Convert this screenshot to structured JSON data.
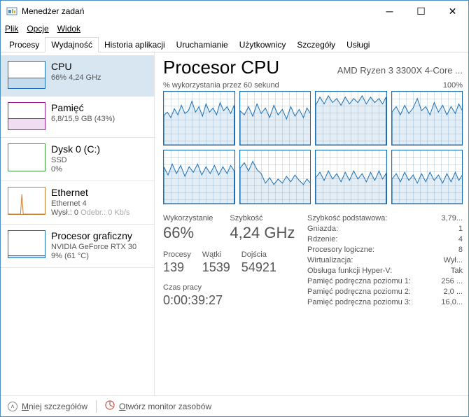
{
  "window": {
    "title": "Menedżer zadań"
  },
  "menu": {
    "file": "Plik",
    "options": "Opcje",
    "view": "Widok"
  },
  "tabs": {
    "t0": "Procesy",
    "t1": "Wydajność",
    "t2": "Historia aplikacji",
    "t3": "Uruchamianie",
    "t4": "Użytkownicy",
    "t5": "Szczegóły",
    "t6": "Usługi"
  },
  "sidebar": {
    "cpu": {
      "title": "CPU",
      "sub": "66%  4,24 GHz"
    },
    "mem": {
      "title": "Pamięć",
      "sub": "6,8/15,9 GB (43%)"
    },
    "disk": {
      "title": "Dysk 0 (C:)",
      "sub": "SSD",
      "sub2": "0%"
    },
    "net": {
      "title": "Ethernet",
      "sub": "Ethernet 4",
      "sent_lbl": "Wysł.: ",
      "sent_val": "0",
      "recv_lbl": " Odebr.: ",
      "recv_val": "0 Kb/s"
    },
    "gpu": {
      "title": "Procesor graficzny",
      "sub": "NVIDIA GeForce RTX 30",
      "sub2": "9%  (61 °C)"
    }
  },
  "main": {
    "heading": "Procesor CPU",
    "model": "AMD Ryzen 3 3300X 4-Core ...",
    "axis_left": "% wykorzystania przez 60 sekund",
    "axis_right": "100%"
  },
  "stats_left": {
    "util_lbl": "Wykorzystanie",
    "util_val": "66%",
    "speed_lbl": "Szybkość",
    "speed_val": "4,24 GHz",
    "proc_lbl": "Procesy",
    "proc_val": "139",
    "thr_lbl": "Wątki",
    "thr_val": "1539",
    "hnd_lbl": "Dojścia",
    "hnd_val": "54921",
    "up_lbl": "Czas pracy",
    "up_val": "0:00:39:27"
  },
  "stats_right": {
    "r0k": "Szybkość podstawowa:",
    "r0v": "3,79...",
    "r1k": "Gniazda:",
    "r1v": "1",
    "r2k": "Rdzenie:",
    "r2v": "4",
    "r3k": "Procesory logiczne:",
    "r3v": "8",
    "r4k": "Wirtualizacja:",
    "r4v": "Wył...",
    "r5k": "Obsługa funkcji Hyper-V:",
    "r5v": "Tak",
    "r6k": "Pamięć podręczna poziomu 1:",
    "r6v": "256 ...",
    "r7k": "Pamięć podręczna poziomu 2:",
    "r7v": "2,0 ...",
    "r8k": "Pamięć podręczna poziomu 3:",
    "r8v": "16,0..."
  },
  "footer": {
    "fewer": "Mniej szczegółów",
    "resmon": "Otwórz monitor zasobów"
  }
}
